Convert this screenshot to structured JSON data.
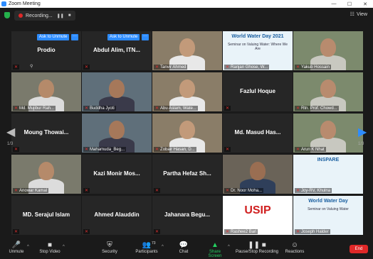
{
  "window": {
    "title": "Zoom Meeting",
    "minimize": "—",
    "maximize": "☐",
    "close": "✕"
  },
  "topbar": {
    "recording_label": "Recording...",
    "pause": "❚❚",
    "stop": "■",
    "view_label": "View"
  },
  "grid": {
    "pager_left": "1/3",
    "pager_right": "1/3",
    "unmute_label": "Ask to Unmute",
    "more_label": "···",
    "tiles": [
      {
        "id": "prodio",
        "name": "Prodio",
        "label": "",
        "type": "name"
      },
      {
        "id": "abdul-alim",
        "name": "Abdul Alim, ITN...",
        "label": "",
        "type": "name"
      },
      {
        "id": "tanvir-ahmed",
        "name": "",
        "label": "Tanvir Ahmed",
        "type": "video"
      },
      {
        "id": "ranjan-ghose",
        "name": "",
        "label": "Ranjan Ghose, W...",
        "type": "slide",
        "slide_title": "World Water Day 2021",
        "slide_text": "Seminar on Valuing Water: Where We Are"
      },
      {
        "id": "yakub-hossain",
        "name": "",
        "label": "Yakub Hossain",
        "type": "video"
      },
      {
        "id": "mujibur",
        "name": "",
        "label": "Md. Mujibur Rah...",
        "type": "video"
      },
      {
        "id": "buddha-jyoti",
        "name": "",
        "label": "Buddha Jyoti",
        "type": "video"
      },
      {
        "id": "abu-aslam",
        "name": "",
        "label": "Abu Aslam, Wate...",
        "type": "video"
      },
      {
        "id": "fazlul-hoque",
        "name": "Fazlul Hoque",
        "label": "",
        "type": "name"
      },
      {
        "id": "rtn-prof",
        "name": "",
        "label": "Rtn. Prof. Chowd...",
        "type": "video"
      },
      {
        "id": "moung-thowai",
        "name": "Moung  Thowai...",
        "label": "",
        "type": "name"
      },
      {
        "id": "mahamuda",
        "name": "",
        "label": "Mahamuda_Beg...",
        "type": "video"
      },
      {
        "id": "zobair-hasan",
        "name": "",
        "label": "Zobair Hasan, D...",
        "type": "video"
      },
      {
        "id": "masud-has",
        "name": "Md. Masud Has...",
        "label": "",
        "type": "name"
      },
      {
        "id": "arun-k-nhat",
        "name": "",
        "label": "Arun K Nhat",
        "type": "video",
        "active": true
      },
      {
        "id": "anowar-kamal",
        "name": "",
        "label": "Anowar Kamal",
        "type": "video"
      },
      {
        "id": "kazi-monir",
        "name": "Kazi Monir Mos...",
        "label": "",
        "type": "name"
      },
      {
        "id": "partha-hefaz",
        "name": "Partha Hefaz Sh...",
        "label": "",
        "type": "name"
      },
      {
        "id": "noor-moha",
        "name": "",
        "label": "Dr. Noor Moha...",
        "type": "video"
      },
      {
        "id": "joy-rv",
        "name": "",
        "label": "Joy-RV, Khulna",
        "type": "slide",
        "slide_title": "INSPARE",
        "slide_text": ""
      },
      {
        "id": "serajul-islam",
        "name": "MD. Serajul Islam",
        "label": "",
        "type": "name"
      },
      {
        "id": "ahmed-alauddin",
        "name": "Ahmed Alauddin",
        "label": "",
        "type": "name"
      },
      {
        "id": "jahanara",
        "name": "Jahanara Begu...",
        "label": "",
        "type": "name"
      },
      {
        "id": "rashee2-bari",
        "name": "",
        "label": "Rashee2 Bari",
        "type": "logo",
        "logo_text": "USIP"
      },
      {
        "id": "joseph-halder",
        "name": "",
        "label": "Joseph Halder",
        "type": "slide",
        "slide_title": "World Water Day",
        "slide_text": "Seminar on Valuing Water"
      }
    ]
  },
  "toolbar": {
    "unmute": "Unmute",
    "stop_video": "Stop Video",
    "security": "Security",
    "participants": "Participants",
    "participants_count": "73",
    "chat": "Chat",
    "share_screen": "Share Screen",
    "pause_stop_recording": "Pause/Stop Recording",
    "reactions": "Reactions",
    "end": "End"
  },
  "colors": {
    "accent": "#2d8cff",
    "active_speaker": "#8fd14f",
    "end": "#e02828",
    "share": "#23d160",
    "muted": "#e03030"
  }
}
